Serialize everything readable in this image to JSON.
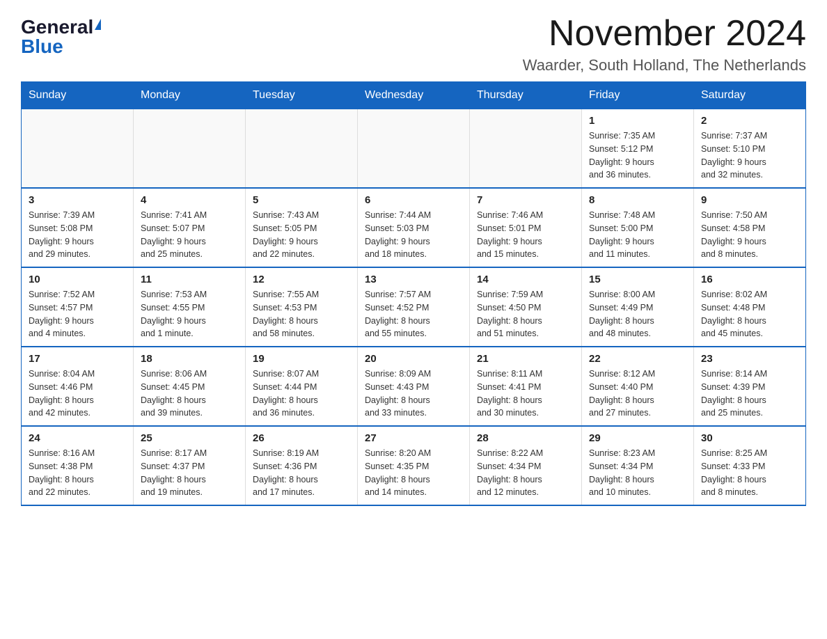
{
  "logo": {
    "general": "General",
    "blue": "Blue"
  },
  "title": "November 2024",
  "subtitle": "Waarder, South Holland, The Netherlands",
  "days_of_week": [
    "Sunday",
    "Monday",
    "Tuesday",
    "Wednesday",
    "Thursday",
    "Friday",
    "Saturday"
  ],
  "weeks": [
    [
      {
        "day": "",
        "info": ""
      },
      {
        "day": "",
        "info": ""
      },
      {
        "day": "",
        "info": ""
      },
      {
        "day": "",
        "info": ""
      },
      {
        "day": "",
        "info": ""
      },
      {
        "day": "1",
        "info": "Sunrise: 7:35 AM\nSunset: 5:12 PM\nDaylight: 9 hours\nand 36 minutes."
      },
      {
        "day": "2",
        "info": "Sunrise: 7:37 AM\nSunset: 5:10 PM\nDaylight: 9 hours\nand 32 minutes."
      }
    ],
    [
      {
        "day": "3",
        "info": "Sunrise: 7:39 AM\nSunset: 5:08 PM\nDaylight: 9 hours\nand 29 minutes."
      },
      {
        "day": "4",
        "info": "Sunrise: 7:41 AM\nSunset: 5:07 PM\nDaylight: 9 hours\nand 25 minutes."
      },
      {
        "day": "5",
        "info": "Sunrise: 7:43 AM\nSunset: 5:05 PM\nDaylight: 9 hours\nand 22 minutes."
      },
      {
        "day": "6",
        "info": "Sunrise: 7:44 AM\nSunset: 5:03 PM\nDaylight: 9 hours\nand 18 minutes."
      },
      {
        "day": "7",
        "info": "Sunrise: 7:46 AM\nSunset: 5:01 PM\nDaylight: 9 hours\nand 15 minutes."
      },
      {
        "day": "8",
        "info": "Sunrise: 7:48 AM\nSunset: 5:00 PM\nDaylight: 9 hours\nand 11 minutes."
      },
      {
        "day": "9",
        "info": "Sunrise: 7:50 AM\nSunset: 4:58 PM\nDaylight: 9 hours\nand 8 minutes."
      }
    ],
    [
      {
        "day": "10",
        "info": "Sunrise: 7:52 AM\nSunset: 4:57 PM\nDaylight: 9 hours\nand 4 minutes."
      },
      {
        "day": "11",
        "info": "Sunrise: 7:53 AM\nSunset: 4:55 PM\nDaylight: 9 hours\nand 1 minute."
      },
      {
        "day": "12",
        "info": "Sunrise: 7:55 AM\nSunset: 4:53 PM\nDaylight: 8 hours\nand 58 minutes."
      },
      {
        "day": "13",
        "info": "Sunrise: 7:57 AM\nSunset: 4:52 PM\nDaylight: 8 hours\nand 55 minutes."
      },
      {
        "day": "14",
        "info": "Sunrise: 7:59 AM\nSunset: 4:50 PM\nDaylight: 8 hours\nand 51 minutes."
      },
      {
        "day": "15",
        "info": "Sunrise: 8:00 AM\nSunset: 4:49 PM\nDaylight: 8 hours\nand 48 minutes."
      },
      {
        "day": "16",
        "info": "Sunrise: 8:02 AM\nSunset: 4:48 PM\nDaylight: 8 hours\nand 45 minutes."
      }
    ],
    [
      {
        "day": "17",
        "info": "Sunrise: 8:04 AM\nSunset: 4:46 PM\nDaylight: 8 hours\nand 42 minutes."
      },
      {
        "day": "18",
        "info": "Sunrise: 8:06 AM\nSunset: 4:45 PM\nDaylight: 8 hours\nand 39 minutes."
      },
      {
        "day": "19",
        "info": "Sunrise: 8:07 AM\nSunset: 4:44 PM\nDaylight: 8 hours\nand 36 minutes."
      },
      {
        "day": "20",
        "info": "Sunrise: 8:09 AM\nSunset: 4:43 PM\nDaylight: 8 hours\nand 33 minutes."
      },
      {
        "day": "21",
        "info": "Sunrise: 8:11 AM\nSunset: 4:41 PM\nDaylight: 8 hours\nand 30 minutes."
      },
      {
        "day": "22",
        "info": "Sunrise: 8:12 AM\nSunset: 4:40 PM\nDaylight: 8 hours\nand 27 minutes."
      },
      {
        "day": "23",
        "info": "Sunrise: 8:14 AM\nSunset: 4:39 PM\nDaylight: 8 hours\nand 25 minutes."
      }
    ],
    [
      {
        "day": "24",
        "info": "Sunrise: 8:16 AM\nSunset: 4:38 PM\nDaylight: 8 hours\nand 22 minutes."
      },
      {
        "day": "25",
        "info": "Sunrise: 8:17 AM\nSunset: 4:37 PM\nDaylight: 8 hours\nand 19 minutes."
      },
      {
        "day": "26",
        "info": "Sunrise: 8:19 AM\nSunset: 4:36 PM\nDaylight: 8 hours\nand 17 minutes."
      },
      {
        "day": "27",
        "info": "Sunrise: 8:20 AM\nSunset: 4:35 PM\nDaylight: 8 hours\nand 14 minutes."
      },
      {
        "day": "28",
        "info": "Sunrise: 8:22 AM\nSunset: 4:34 PM\nDaylight: 8 hours\nand 12 minutes."
      },
      {
        "day": "29",
        "info": "Sunrise: 8:23 AM\nSunset: 4:34 PM\nDaylight: 8 hours\nand 10 minutes."
      },
      {
        "day": "30",
        "info": "Sunrise: 8:25 AM\nSunset: 4:33 PM\nDaylight: 8 hours\nand 8 minutes."
      }
    ]
  ]
}
